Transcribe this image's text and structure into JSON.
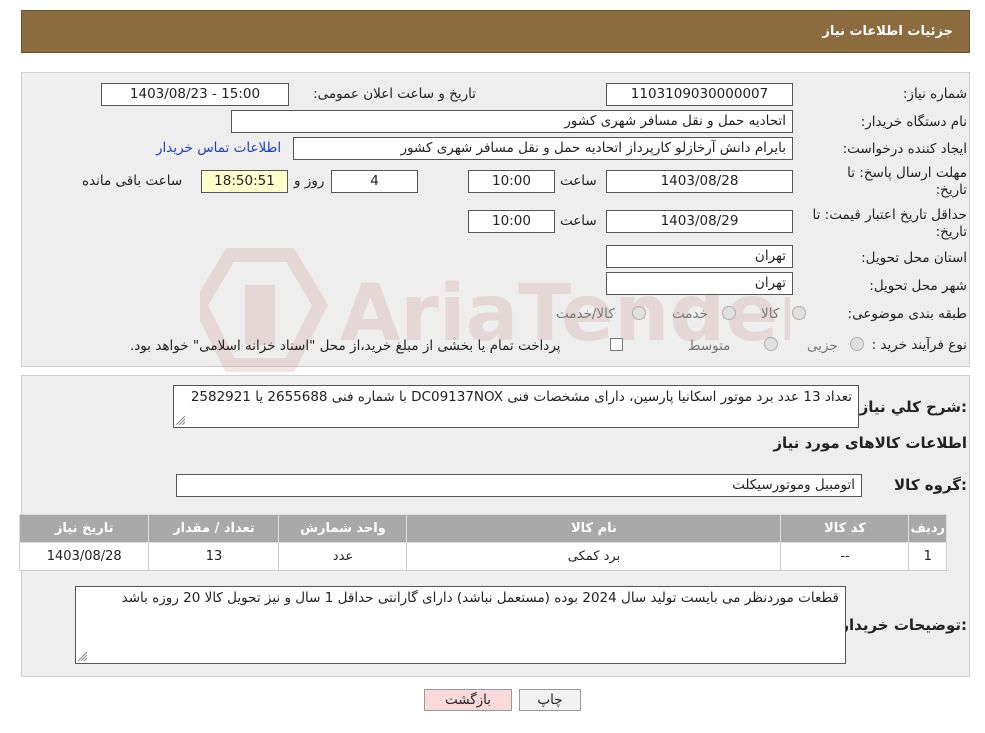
{
  "header": {
    "title": "جزئیات اطلاعات نیاز"
  },
  "form": {
    "need_number_label": "شماره نیاز:",
    "need_number": "1103109030000007",
    "announce_label": "تاریخ و ساعت اعلان عمومی:",
    "announce_value": "1403/08/23 - 15:00",
    "buyer_org_label": "نام دستگاه خریدار:",
    "buyer_org": "اتحادیه حمل و نقل مسافر شهری کشور",
    "creator_label": "ایجاد کننده درخواست:",
    "creator": "بایرام دانش آرخازلو کارپرداز اتحادیه حمل و نقل مسافر شهری کشور",
    "contact_link": "اطلاعات تماس خریدار",
    "deadline_label_1": "مهلت ارسال پاسخ: تا",
    "deadline_label_2": "تاریخ:",
    "deadline_date": "1403/08/28",
    "time_label": "ساعت",
    "deadline_time": "10:00",
    "days_value": "4",
    "days_label": "روز و",
    "remaining_time": "18:50:51",
    "remaining_label": "ساعت باقی مانده",
    "validity_label_1": "حداقل تاریخ اعتبار قیمت: تا",
    "validity_label_2": "تاریخ:",
    "validity_date": "1403/08/29",
    "validity_time": "10:00",
    "province_label": "استان محل تحویل:",
    "province": "تهران",
    "city_label": "شهر محل تحویل:",
    "city": "تهران",
    "category_label": "طبقه بندی موضوعی:",
    "category_options": [
      "کالا",
      "خدمت",
      "کالا/خدمت"
    ],
    "process_label": "نوع فرآیند خرید :",
    "process_options": [
      "جزیی",
      "متوسط"
    ],
    "payment_note": "پرداخت تمام یا بخشی از مبلغ خرید،از محل \"اسناد خزانه اسلامی\" خواهد بود."
  },
  "description": {
    "label": "شرح كلي نياز:",
    "text": "تعداد 13 عدد برد موتور اسکانیا پارسین، دارای مشخصات فنی  DC09137NOX با شماره فنی 2655688 یا 2582921"
  },
  "goods": {
    "section_title": "اطلاعات کالاهای مورد نیاز",
    "group_label": "گروه کالا:",
    "group_value": "اتومبیل وموتورسیکلت",
    "columns": [
      "ردیف",
      "کد کالا",
      "نام کالا",
      "واحد شمارش",
      "تعداد / مقدار",
      "تاریخ نیاز"
    ],
    "rows": [
      [
        "1",
        "--",
        "برد کمکی",
        "عدد",
        "13",
        "1403/08/28"
      ]
    ]
  },
  "buyer_notes": {
    "label": "توضیحات خریدار:",
    "text": "قطعات موردنظر می بایست تولید سال 2024 بوده (مستعمل نباشد) دارای گارانتی حداقل 1 سال و نیز تحویل کالا 20 روزه باشد"
  },
  "buttons": {
    "print": "چاپ",
    "back": "بازگشت"
  },
  "watermark_text": "AriaTender.neT",
  "colors": {
    "header": "#8c6b3f",
    "table_head": "#a9a9a9",
    "link": "#1d3fc0",
    "back_button": "#f8dada"
  }
}
